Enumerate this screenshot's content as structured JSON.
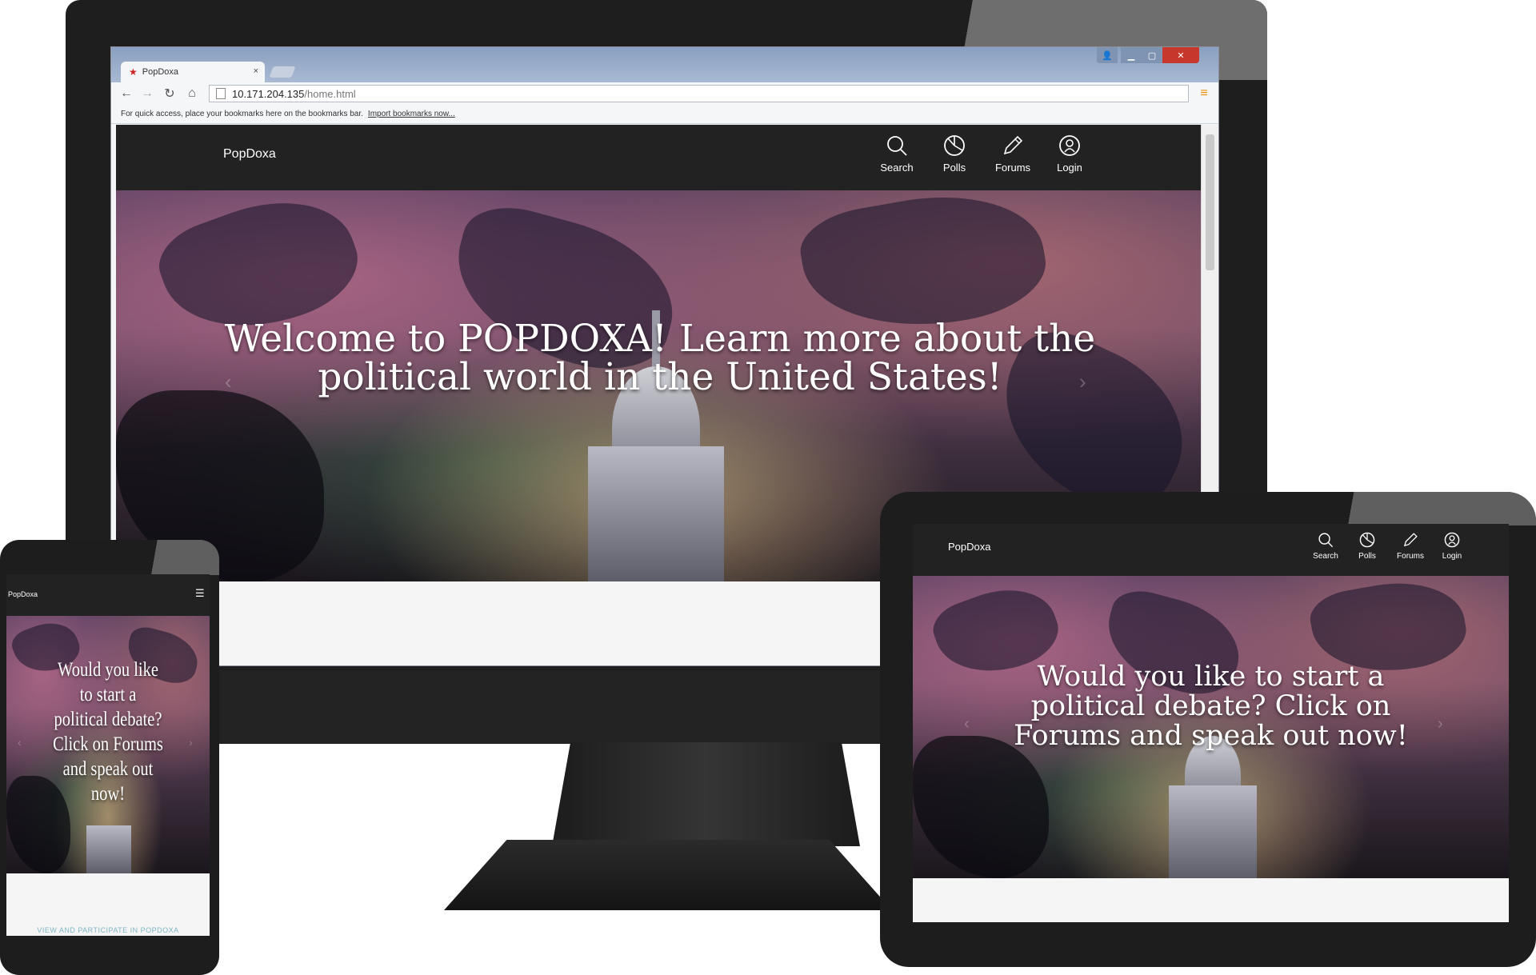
{
  "browser": {
    "tab_title": "PopDoxa",
    "tab_close": "×",
    "url_host": "10.171.204.135",
    "url_path": "/home.html",
    "bookmarks_text": "For quick access, place your bookmarks here on the bookmarks bar.",
    "bookmarks_link": "Import bookmarks now..."
  },
  "site": {
    "brand": "PopDoxa",
    "nav": [
      {
        "label": "Search",
        "icon": "search-icon"
      },
      {
        "label": "Polls",
        "icon": "pie-chart-icon"
      },
      {
        "label": "Forums",
        "icon": "pencil-icon"
      },
      {
        "label": "Login",
        "icon": "user-icon"
      }
    ]
  },
  "desktop": {
    "hero_line1": "Welcome to POPDOXA! Learn more about the",
    "hero_line2": "political world in the United States!"
  },
  "tablet": {
    "hero_line1": "Would you like to start a",
    "hero_line2": "political debate? Click on",
    "hero_line3": "Forums and speak out now!"
  },
  "phone": {
    "menu_icon": "☰",
    "hero_lines": [
      "Would you like",
      "to start a",
      "political debate?",
      "Click on Forums",
      "and speak out",
      "now!"
    ],
    "link_text": "VIEW AND PARTICIPATE IN POPDOXA"
  },
  "arrows": {
    "prev": "‹",
    "next": "›"
  },
  "colors": {
    "nav_bg": "#222222",
    "accent_menu": "#e8900c"
  }
}
